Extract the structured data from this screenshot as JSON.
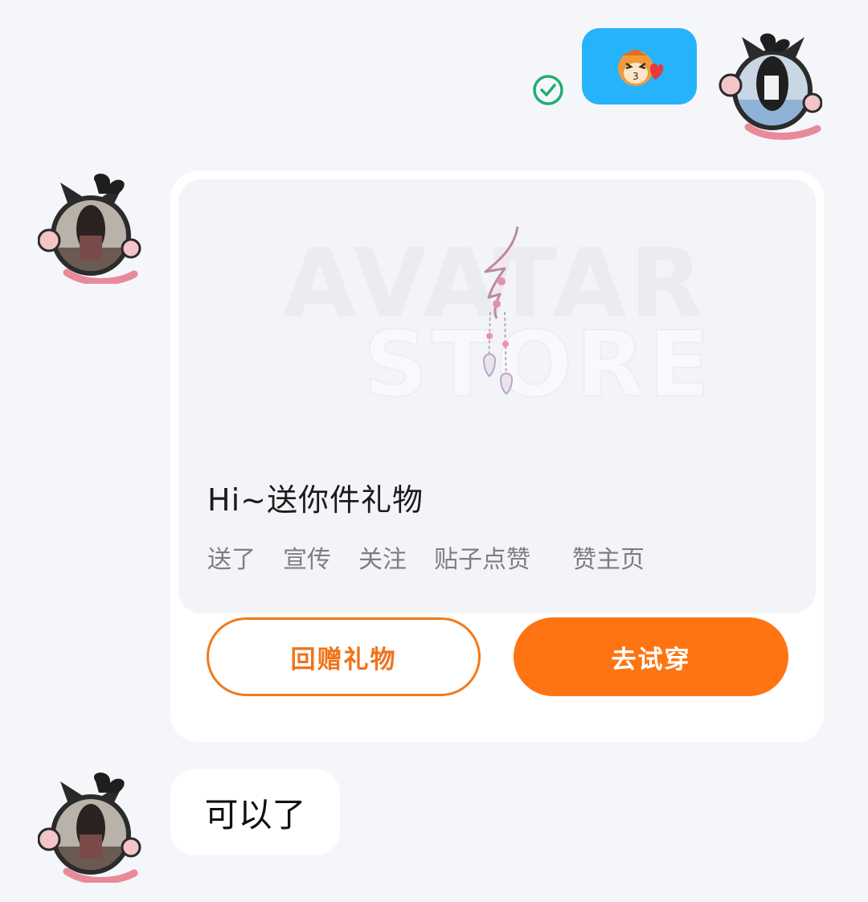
{
  "messages": {
    "outgoing": {
      "sticker_icon": "monkey-kiss-sticker-icon",
      "status_icon": "read-check-icon",
      "status_color": "#1fae74",
      "bubble_color": "#27b3fb"
    },
    "gift_card": {
      "watermark_line1": "AVATAR",
      "watermark_line2": "STORE",
      "item_icon": "pendant-earring-icon",
      "title": "Hi~送你件礼物",
      "tags": [
        "送了",
        "宣传",
        "关注",
        "贴子点赞",
        "赞主页"
      ],
      "return_gift_label": "回赠礼物",
      "try_on_label": "去试穿",
      "accent_color": "#ff7412"
    },
    "incoming_text": "可以了"
  }
}
